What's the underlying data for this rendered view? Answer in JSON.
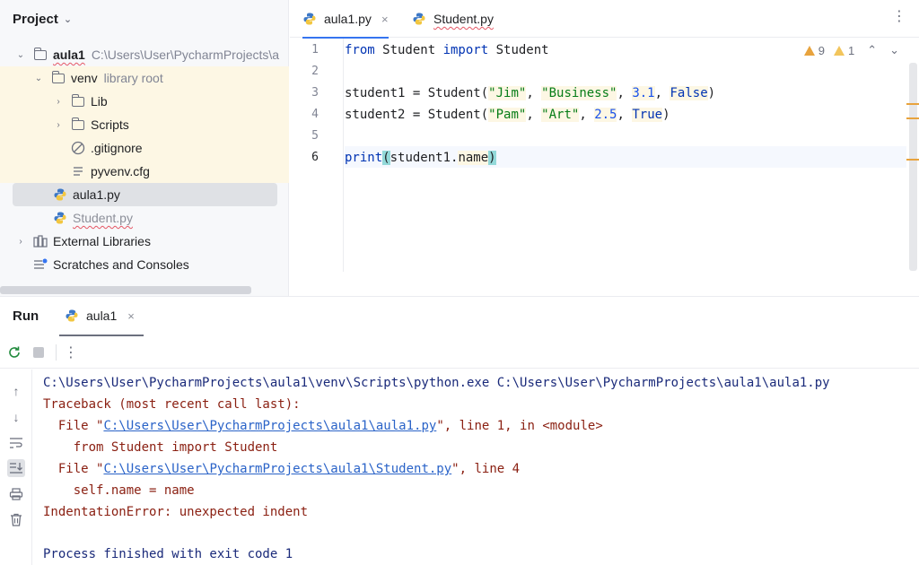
{
  "project": {
    "title": "Project",
    "tree": [
      {
        "label": "aula1",
        "hint": "C:\\Users\\User\\PycharmProjects\\a"
      },
      {
        "label": "venv",
        "hint": "library root"
      },
      {
        "label": "Lib"
      },
      {
        "label": "Scripts"
      },
      {
        "label": ".gitignore"
      },
      {
        "label": "pyvenv.cfg"
      },
      {
        "label": "aula1.py"
      },
      {
        "label": "Student.py"
      },
      {
        "label": "External Libraries"
      },
      {
        "label": "Scratches and Consoles"
      }
    ]
  },
  "editor": {
    "tabs": [
      {
        "label": "aula1.py",
        "close": "×"
      },
      {
        "label": "Student.py"
      }
    ],
    "menu": "⋮",
    "warnings": {
      "strong": "9",
      "weak": "1"
    },
    "line_numbers": [
      "1",
      "2",
      "3",
      "4",
      "5",
      "6"
    ],
    "code": {
      "l1": {
        "kw1": "from",
        "t1": " Student ",
        "kw2": "import",
        "t2": " Student"
      },
      "l3": {
        "t1": "student1 = Student(",
        "s1": "\"Jim\"",
        "c1": ", ",
        "s2": "\"Business\"",
        "c2": ", ",
        "n1": "3.1",
        "c3": ", ",
        "k1": "False",
        "t2": ")"
      },
      "l4": {
        "t1": "student2 = Student(",
        "s1": "\"Pam\"",
        "c1": ", ",
        "s2": "\"Art\"",
        "c2": ", ",
        "n1": "2.5",
        "c3": ", ",
        "k1": "True",
        "t2": ")"
      },
      "l6": {
        "t1": "print",
        "b1": "(",
        "t2": "student1.",
        "f1": "name",
        "b2": ")"
      }
    }
  },
  "run": {
    "title": "Run",
    "tab_label": "aula1",
    "tab_close": "×",
    "output": {
      "cmd": "C:\\Users\\User\\PycharmProjects\\aula1\\venv\\Scripts\\python.exe C:\\Users\\User\\PycharmProjects\\aula1\\aula1.py",
      "traceback": "Traceback (most recent call last):",
      "file1_pre": "  File \"",
      "file1_link": "C:\\Users\\User\\PycharmProjects\\aula1\\aula1.py",
      "file1_post": "\", line 1, in <module>",
      "src1": "    from Student import Student",
      "file2_pre": "  File \"",
      "file2_link": "C:\\Users\\User\\PycharmProjects\\aula1\\Student.py",
      "file2_post": "\", line 4",
      "src2": "    self.name = name",
      "error": "IndentationError: unexpected indent",
      "finished": "Process finished with exit code 1"
    }
  },
  "colors": {
    "accent": "#3574f0",
    "warning": "#e8a33d",
    "error_text": "#8a1f11",
    "link": "#2a63c8"
  }
}
